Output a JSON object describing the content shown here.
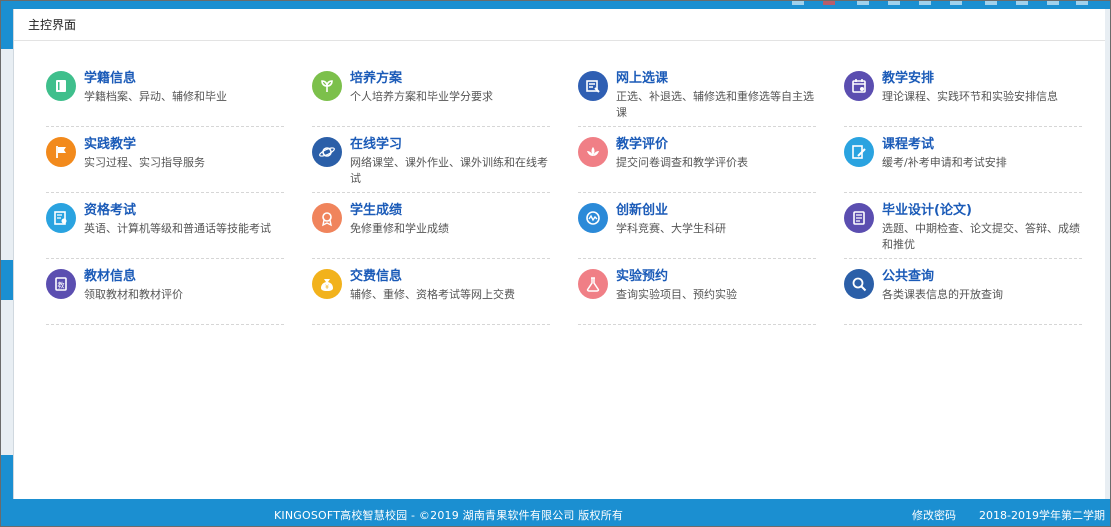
{
  "page": {
    "title": "主控界面"
  },
  "modules": [
    {
      "title": "学籍信息",
      "desc": "学籍档案、异动、辅修和毕业",
      "icon": "book-icon",
      "color": "#3fbf8c"
    },
    {
      "title": "培养方案",
      "desc": "个人培养方案和毕业学分要求",
      "icon": "seedling-icon",
      "color": "#7cc04b"
    },
    {
      "title": "网上选课",
      "desc": "正选、补退选、辅修选和重修选等自主选课",
      "icon": "course-selection-icon",
      "color": "#2f5fb3"
    },
    {
      "title": "教学安排",
      "desc": "理论课程、实践环节和实验安排信息",
      "icon": "calendar-icon",
      "color": "#5b4eb0"
    },
    {
      "title": "实践教学",
      "desc": "实习过程、实习指导服务",
      "icon": "flag-icon",
      "color": "#f28a1c"
    },
    {
      "title": "在线学习",
      "desc": "网络课堂、课外作业、课外训练和在线考试",
      "icon": "planet-icon",
      "color": "#2b5fa8"
    },
    {
      "title": "教学评价",
      "desc": "提交问卷调查和教学评价表",
      "icon": "lotus-icon",
      "color": "#f07f86"
    },
    {
      "title": "课程考试",
      "desc": "缓考/补考申请和考试安排",
      "icon": "exam-pen-icon",
      "color": "#2aa3e0"
    },
    {
      "title": "资格考试",
      "desc": "英语、计算机等级和普通话等技能考试",
      "icon": "certificate-icon",
      "color": "#2aa3e0"
    },
    {
      "title": "学生成绩",
      "desc": "免修重修和学业成绩",
      "icon": "medal-icon",
      "color": "#f0845c"
    },
    {
      "title": "创新创业",
      "desc": "学科竞赛、大学生科研",
      "icon": "innovation-icon",
      "color": "#2b8ad8"
    },
    {
      "title": "毕业设计(论文)",
      "desc": "选题、中期检查、论文提交、答辩、成绩和推优",
      "icon": "thesis-icon",
      "color": "#5b4eb0"
    },
    {
      "title": "教材信息",
      "desc": "领取教材和教材评价",
      "icon": "textbook-icon",
      "color": "#5b4eb0"
    },
    {
      "title": "交费信息",
      "desc": "辅修、重修、资格考试等网上交费",
      "icon": "money-bag-icon",
      "color": "#f2b21c"
    },
    {
      "title": "实验预约",
      "desc": "查询实验项目、预约实验",
      "icon": "flask-icon",
      "color": "#f07f86"
    },
    {
      "title": "公共查询",
      "desc": "各类课表信息的开放查询",
      "icon": "search-icon",
      "color": "#2b5fa8"
    }
  ],
  "footer": {
    "copyright": "KINGOSOFT高校智慧校园 - ©2019 湖南青果软件有限公司 版权所有",
    "change_password": "修改密码",
    "term": "2018-2019学年第二学期"
  }
}
